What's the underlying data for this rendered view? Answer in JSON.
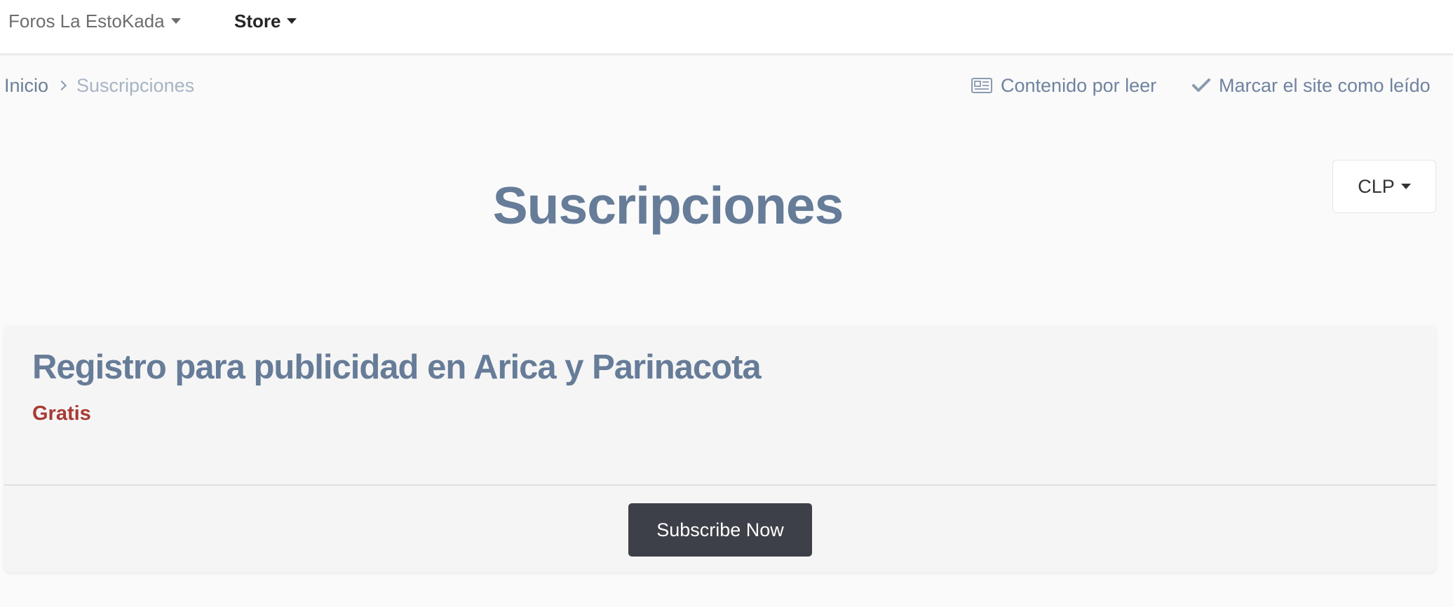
{
  "topnav": {
    "forums_label": "Foros La EstoKada",
    "store_label": "Store"
  },
  "breadcrumb": {
    "home": "Inicio",
    "current": "Suscripciones"
  },
  "actions": {
    "unread": {
      "label": "Contenido por leer",
      "icon": "newspaper-icon"
    },
    "mark_read": {
      "label": "Marcar el site como leído",
      "icon": "check-icon"
    }
  },
  "page": {
    "title": "Suscripciones",
    "currency": "CLP"
  },
  "subscription": {
    "title": "Registro para publicidad en Arica y Parinacota",
    "price": "Gratis",
    "button_label": "Subscribe Now"
  },
  "colors": {
    "title": "#667c98",
    "price": "#a83a34",
    "button": "#3d4048"
  }
}
